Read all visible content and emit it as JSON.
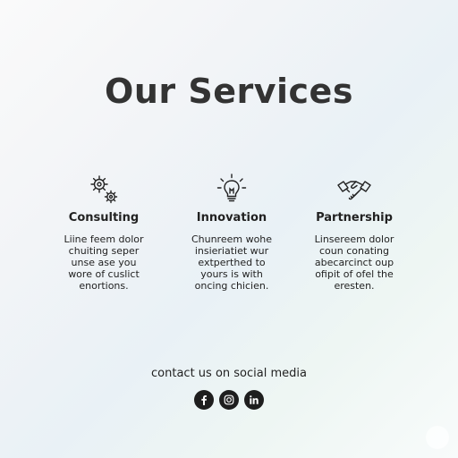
{
  "page": {
    "title": "Our Services"
  },
  "services": [
    {
      "title": "Consulting",
      "icon": "gears-icon",
      "description": "Liine feem dolor\nchuiting seper\nunse ase you\nwore of cuslict\nenortions."
    },
    {
      "title": "Innovation",
      "icon": "lightbulb-icon",
      "description": "Chunreem wohe\ninsieriatiet wur\nextperthed to\nyours is with\noncing chicien."
    },
    {
      "title": "Partnership",
      "icon": "handshake-icon",
      "description": "Linsereem dolor\ncoun conating\nabecarcinct oup\nofipit of ofel the\neresten."
    }
  ],
  "contact": {
    "text": "contact us on social media",
    "links": [
      {
        "icon": "facebook-icon"
      },
      {
        "icon": "instagram-icon"
      },
      {
        "icon": "linkedin-icon"
      }
    ]
  },
  "colors": {
    "title": "#333333",
    "text": "#222222",
    "social_bg": "#1e1e1e"
  }
}
